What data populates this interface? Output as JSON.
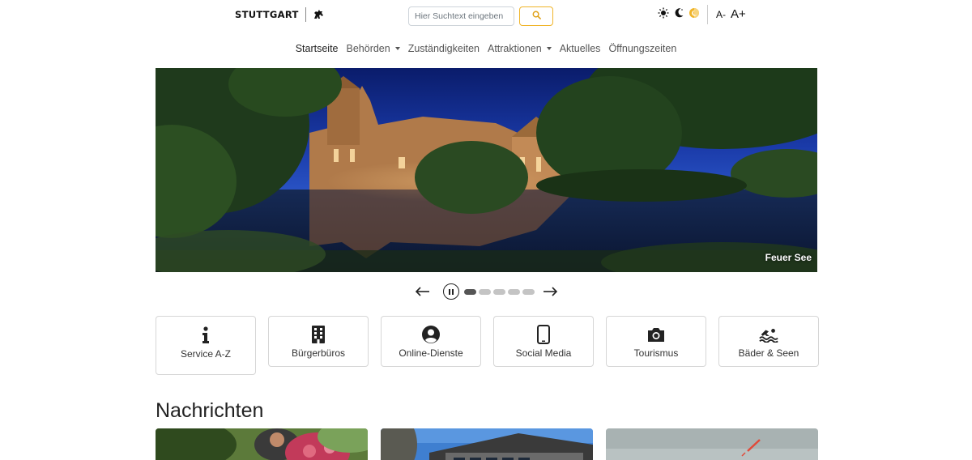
{
  "header": {
    "logo_text": "STUTTGART",
    "search": {
      "placeholder": "Hier Suchtext eingeben",
      "value": ""
    },
    "search_button_icon": "search-icon",
    "theme_icons": [
      "sun-icon",
      "moon-icon",
      "auto-theme-icon"
    ],
    "font_size": {
      "decrease_label": "A-",
      "increase_label": "A+"
    },
    "colors": {
      "accent": "#f0b429",
      "text": "#212529"
    }
  },
  "nav": {
    "items": [
      {
        "label": "Startseite",
        "active": true,
        "dropdown": false
      },
      {
        "label": "Behörden",
        "active": false,
        "dropdown": true
      },
      {
        "label": "Zuständigkeiten",
        "active": false,
        "dropdown": false
      },
      {
        "label": "Attraktionen",
        "active": false,
        "dropdown": true
      },
      {
        "label": "Aktuelles",
        "active": false,
        "dropdown": false
      },
      {
        "label": "Öffnungszeiten",
        "active": false,
        "dropdown": false
      }
    ]
  },
  "hero": {
    "caption": "Feuer See",
    "slide_count": 5,
    "active_slide": 1
  },
  "tiles": [
    {
      "label": "Service A-Z",
      "icon": "info-icon"
    },
    {
      "label": "Bürgerbüros",
      "icon": "building-icon"
    },
    {
      "label": "Online-Dienste",
      "icon": "user-circle-icon"
    },
    {
      "label": "Social Media",
      "icon": "smartphone-icon"
    },
    {
      "label": "Tourismus",
      "icon": "camera-icon"
    },
    {
      "label": "Bäder & Seen",
      "icon": "swimmer-icon"
    }
  ],
  "news": {
    "heading": "Nachrichten"
  }
}
